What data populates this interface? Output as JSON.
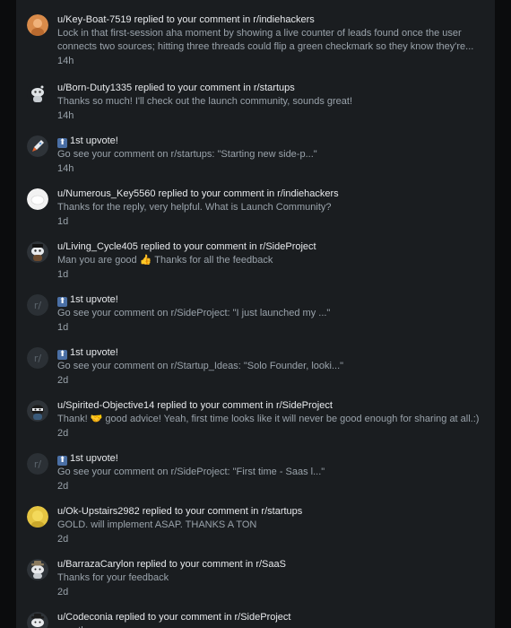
{
  "colors": {
    "background": "#0b0c0d",
    "panel": "#1a1d20",
    "title_text": "#e8eaed",
    "secondary_text": "#9aa3ab",
    "upvote_badge": "#4a6fa5"
  },
  "notifications": [
    {
      "title": "u/Key-Boat-7519 replied to your comment in r/indiehackers",
      "body": "Lock in that first-session aha moment by showing a live counter of leads found once the user connects two sources; hitting three threads could flip a green checkmark so they know they're...",
      "time": "14h",
      "avatar_icon": "orange-avatar-icon"
    },
    {
      "title": "u/Born-Duty1335 replied to your comment in r/startups",
      "body": "Thanks so much! I'll check out the launch community, sounds great!",
      "time": "14h",
      "avatar_icon": "snoo-avatar-icon"
    },
    {
      "title": "1st upvote!",
      "body": "Go see your comment on r/startups: \"Starting new side-p...\"",
      "time": "14h",
      "avatar_icon": "rocket-avatar-icon"
    },
    {
      "title": "u/Numerous_Key5560 replied to your comment in r/indiehackers",
      "body": "Thanks for the reply, very helpful. What is Launch Community?",
      "time": "1d",
      "avatar_icon": "white-avatar-icon"
    },
    {
      "title": "u/Living_Cycle405 replied to your comment in r/SideProject",
      "body": "Man you are good 👍 Thanks for all the feedback",
      "time": "1d",
      "avatar_icon": "snoo-dark-avatar-icon"
    },
    {
      "title": "1st upvote!",
      "body": "Go see your comment on r/SideProject: \"I just launched my ...\"",
      "time": "1d",
      "avatar_icon": "subreddit-avatar-icon"
    },
    {
      "title": "1st upvote!",
      "body": "Go see your comment on r/Startup_Ideas: \"Solo Founder, looki...\"",
      "time": "2d",
      "avatar_icon": "subreddit-avatar-icon"
    },
    {
      "title": "u/Spirited-Objective14 replied to your comment in r/SideProject",
      "body": "Thank! 🤝 good advice! Yeah, first time looks like it will never be good enough for sharing at all.:)",
      "time": "2d",
      "avatar_icon": "ninja-avatar-icon"
    },
    {
      "title": "1st upvote!",
      "body": "Go see your comment on r/SideProject: \"First time - Saas l...\"",
      "time": "2d",
      "avatar_icon": "subreddit-avatar-icon"
    },
    {
      "title": "u/Ok-Upstairs2982 replied to your comment in r/startups",
      "body": "GOLD. will implement ASAP. THANKS A TON",
      "time": "2d",
      "avatar_icon": "yellow-avatar-icon"
    },
    {
      "title": "u/BarrazaCarylon replied to your comment in r/SaaS",
      "body": "Thanks for your feedback",
      "time": "2d",
      "avatar_icon": "hat-snoo-avatar-icon"
    },
    {
      "title": "u/Codeconia replied to your comment in r/SideProject",
      "body": "exactly",
      "time": "",
      "avatar_icon": "hat-dark-avatar-icon"
    }
  ]
}
